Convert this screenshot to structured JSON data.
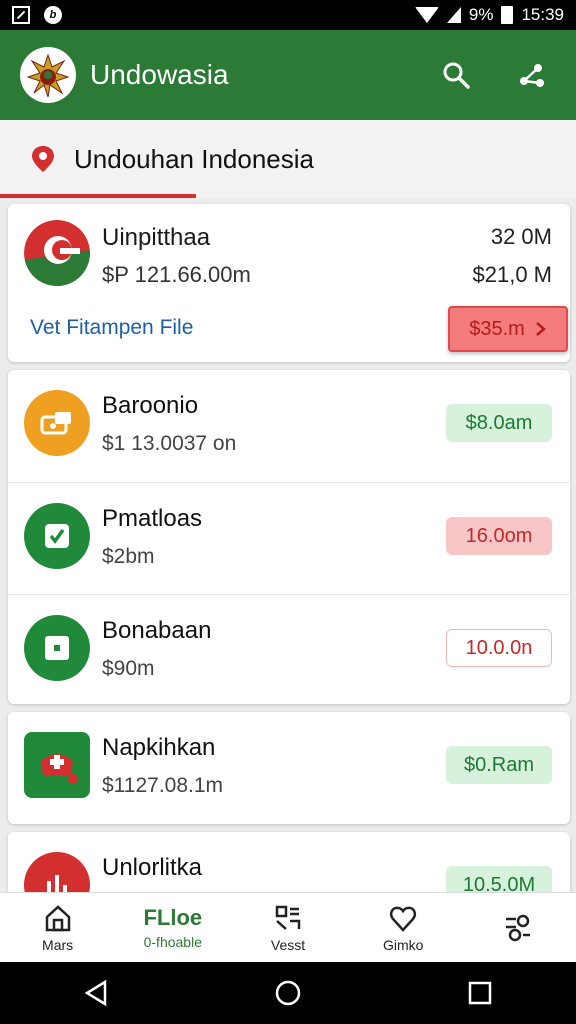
{
  "status_bar": {
    "battery": "9%",
    "time": "15:39"
  },
  "app_bar": {
    "title": "Undowasia",
    "colors": {
      "primary": "#2b7a35",
      "accent": "#d32f2f"
    }
  },
  "section": {
    "title": "Undouhan Indonesia"
  },
  "featured": {
    "name": "Uinpitthaa",
    "sub": "$P 121.66.00m",
    "value_top": "32 0M",
    "value_bottom": "$21,0 M",
    "link": "Vet Fitampen File",
    "button": "$35.m",
    "button_icon": "chevron-right-icon"
  },
  "list": [
    {
      "name": "Baroonio",
      "sub": "$1 13.0037 on",
      "badge": "$8.0am",
      "badge_style": "green",
      "icon": "camera-icon",
      "icon_color": "#f0a020"
    },
    {
      "name": "Pmatloas",
      "sub": "$2bm",
      "badge": "16.0om",
      "badge_style": "red",
      "icon": "check-icon",
      "icon_color": "#218a3a"
    },
    {
      "name": "Bonabaan",
      "sub": "$90m",
      "badge": "10.0.0n",
      "badge_style": "outline",
      "icon": "square-dot-icon",
      "icon_color": "#218a3a"
    }
  ],
  "list2": [
    {
      "name": "Napkihkan",
      "sub": "$1127.08.1m",
      "badge": "$0.Ram",
      "badge_style": "green",
      "icon": "plus-medical-icon",
      "icon_color": "#218a3a"
    }
  ],
  "list3": [
    {
      "name": "Unlorlitka",
      "badge": "10.5.0M",
      "badge_style": "green",
      "icon": "chart-icon",
      "icon_color": "#d32f2f"
    }
  ],
  "bottom_nav": [
    {
      "label": "Mars",
      "icon": "home-icon"
    },
    {
      "word": "FLloe",
      "label": "0-fhoable",
      "icon": "none",
      "active": true
    },
    {
      "label": "Vesst",
      "icon": "grid-icon"
    },
    {
      "label": "Gimko",
      "icon": "heart-icon"
    },
    {
      "label": "",
      "icon": "settings-icon"
    }
  ]
}
